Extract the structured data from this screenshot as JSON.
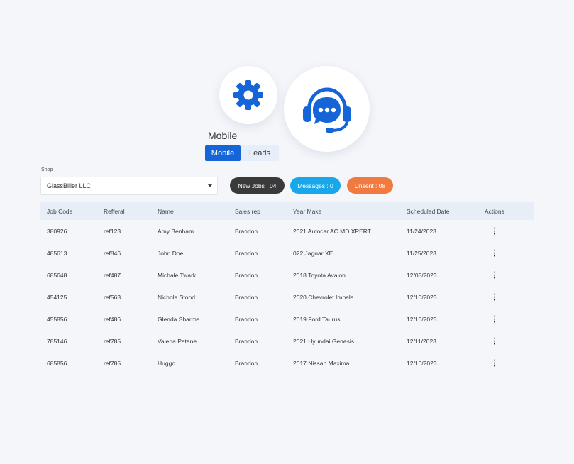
{
  "section_title": "Mobile",
  "tabs": [
    {
      "label": "Mobile",
      "active": true
    },
    {
      "label": "Leads",
      "active": false
    }
  ],
  "shop": {
    "label": "Shop",
    "value": "GlassBiller LLC"
  },
  "badges": {
    "new_jobs": "New Jobs : 04",
    "messages": "Messages : 0",
    "unsent": "Unsent : 08"
  },
  "colors": {
    "accent": "#1565d8",
    "new_jobs": "#3a3a3a",
    "messages": "#19a7ec",
    "unsent": "#f07a3f"
  },
  "icons": [
    "gear-icon",
    "headset-chat-icon",
    "chevron-down-icon",
    "more-vertical-icon"
  ],
  "table": {
    "columns": [
      "Job Code",
      "Refferal",
      "Name",
      "Sales rep",
      "Year Make",
      "Scheduled Date",
      "Actions"
    ],
    "rows": [
      [
        "380926",
        "ref123",
        "Amy Benham",
        "Brandon",
        "2021 Autocar AC MD XPERT",
        "11/24/2023"
      ],
      [
        "485613",
        "ref846",
        "John Doe",
        "Brandon",
        "022 Jaguar XE",
        "11/25/2023"
      ],
      [
        "685648",
        "ref487",
        "Michale Twark",
        "Brandon",
        "2018 Toyota Avalon",
        "12/05/2023"
      ],
      [
        "454125",
        "ref563",
        "Nichola Stood",
        "Brandon",
        "2020 Chevrolet Impala",
        "12/10/2023"
      ],
      [
        "455856",
        "ref486",
        "Glenda Sharma",
        "Brandon",
        "2019 Ford Taurus",
        "12/10/2023"
      ],
      [
        "785146",
        "ref785",
        "Valena Patane",
        "Brandon",
        "2021 Hyundai Genesis",
        "12/11/2023"
      ],
      [
        "685856",
        "ref785",
        "Huggo",
        "Brandon",
        "2017 Nissan Maxima",
        "12/16/2023"
      ]
    ]
  }
}
